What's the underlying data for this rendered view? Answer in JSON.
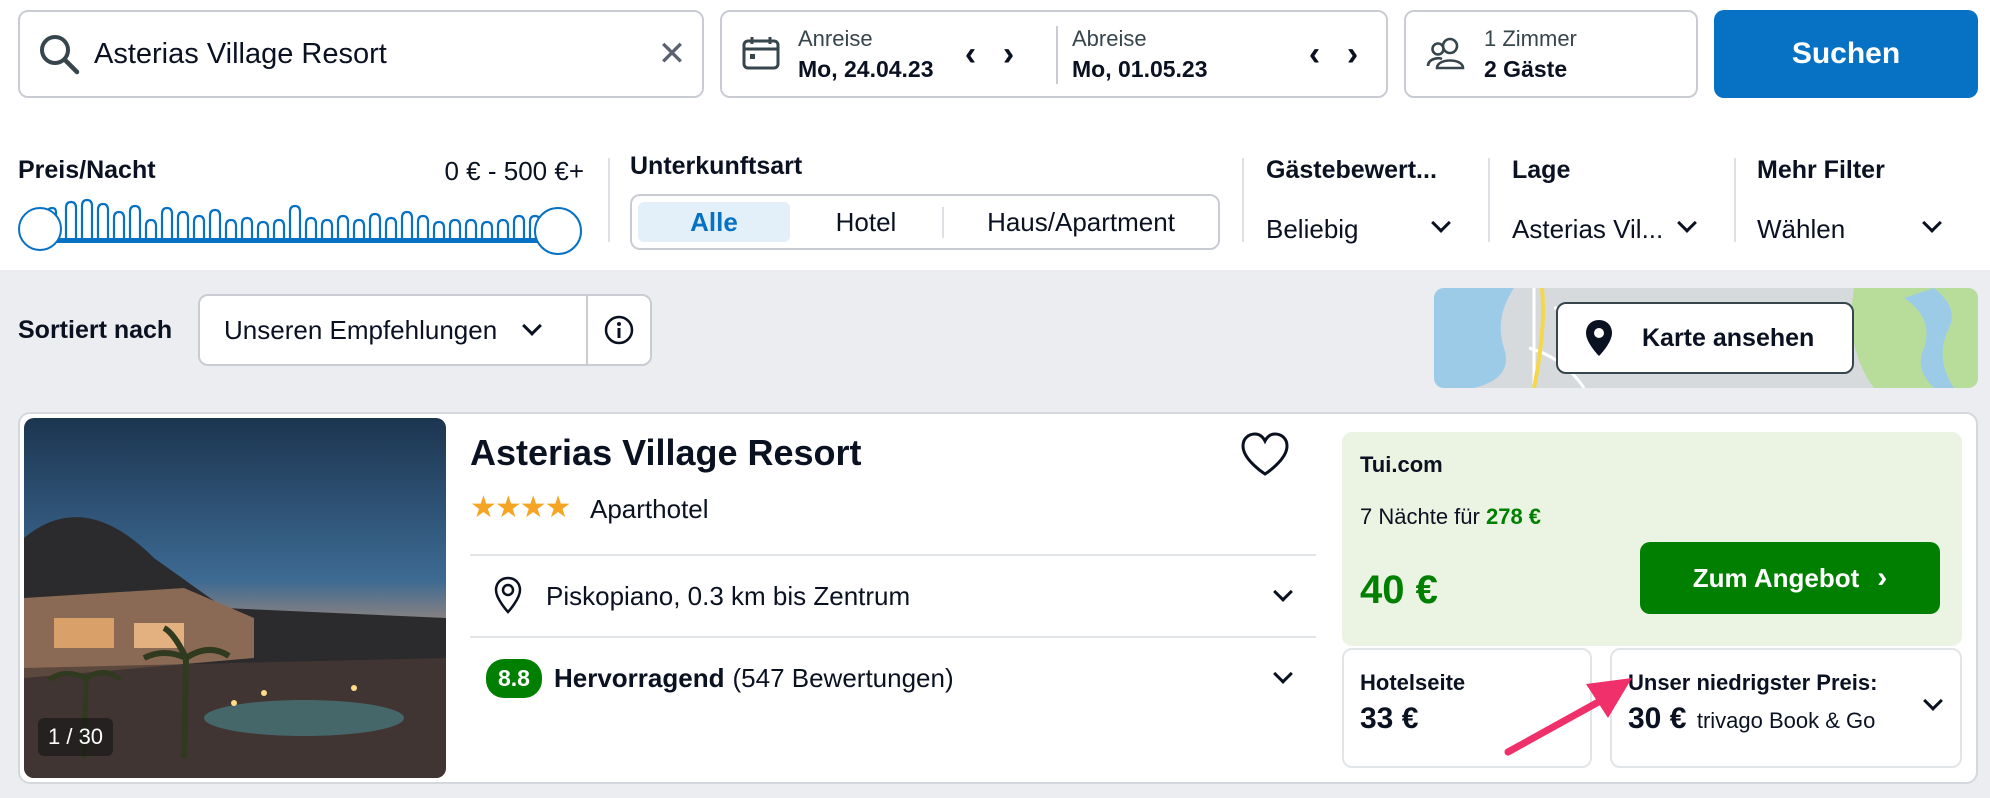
{
  "search": {
    "query": "Asterias Village Resort",
    "clear_icon": "close-icon"
  },
  "dates": {
    "checkin_label": "Anreise",
    "checkin_value": "Mo, 24.04.23",
    "checkout_label": "Abreise",
    "checkout_value": "Mo, 01.05.23"
  },
  "guests": {
    "rooms": "1 Zimmer",
    "guests": "2 Gäste"
  },
  "search_button": "Suchen",
  "filters": {
    "price": {
      "label": "Preis/Nacht",
      "range": "0 € - 500 €+"
    },
    "accommodation": {
      "label": "Unterkunftsart",
      "options": [
        "Alle",
        "Hotel",
        "Haus/Apartment"
      ],
      "selected": "Alle"
    },
    "rating": {
      "label": "Gästebewert...",
      "value": "Beliebig"
    },
    "location": {
      "label": "Lage",
      "value": "Asterias Vil..."
    },
    "more": {
      "label": "Mehr Filter",
      "value": "Wählen"
    }
  },
  "sort": {
    "label": "Sortiert nach",
    "value": "Unseren Empfehlungen"
  },
  "map": {
    "button": "Karte ansehen"
  },
  "hotel": {
    "name": "Asterias Village Resort",
    "stars": 4,
    "type": "Aparthotel",
    "location": "Piskopiano, 0.3 km bis Zentrum",
    "rating_score": "8.8",
    "rating_text": "Hervorragend",
    "rating_count": "(547 Bewertungen)",
    "photo_counter": "1 / 30"
  },
  "deal": {
    "provider": "Tui.com",
    "nights_text": "7 Nächte für",
    "total": "278 €",
    "price": "40 €",
    "button": "Zum Angebot"
  },
  "hotel_site": {
    "label": "Hotelseite",
    "price": "33 €"
  },
  "lowest": {
    "label": "Unser niedrigster Preis:",
    "price": "30 €",
    "source": "trivago Book & Go"
  },
  "colors": {
    "primary": "#0771c4",
    "deal_green": "#007f00",
    "star": "#f5a524",
    "arrow": "#f0306a"
  }
}
